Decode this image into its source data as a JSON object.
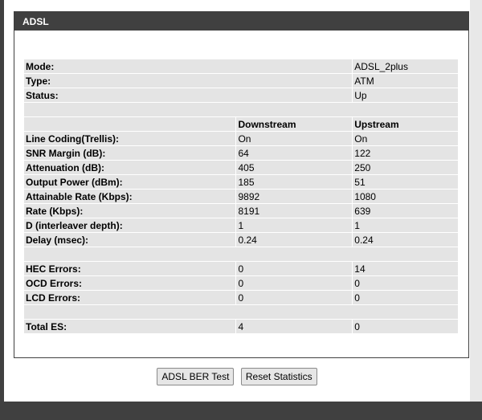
{
  "section": {
    "title": "ADSL"
  },
  "info": [
    {
      "label": "Mode:",
      "value": "ADSL_2plus"
    },
    {
      "label": "Type:",
      "value": "ATM"
    },
    {
      "label": "Status:",
      "value": "Up"
    }
  ],
  "columns": {
    "downstream": "Downstream",
    "upstream": "Upstream"
  },
  "line_stats": [
    {
      "label": "Line Coding(Trellis):",
      "down": "On",
      "up": "On"
    },
    {
      "label": "SNR Margin (dB):",
      "down": "64",
      "up": "122"
    },
    {
      "label": "Attenuation (dB):",
      "down": "405",
      "up": "250"
    },
    {
      "label": "Output Power (dBm):",
      "down": "185",
      "up": "51"
    },
    {
      "label": "Attainable Rate (Kbps):",
      "down": "9892",
      "up": "1080"
    },
    {
      "label": "Rate (Kbps):",
      "down": "8191",
      "up": "639"
    },
    {
      "label": "D (interleaver depth):",
      "down": "1",
      "up": "1"
    },
    {
      "label": "Delay (msec):",
      "down": "0.24",
      "up": "0.24"
    }
  ],
  "errors": [
    {
      "label": "HEC Errors:",
      "down": "0",
      "up": "14"
    },
    {
      "label": "OCD Errors:",
      "down": "0",
      "up": "0"
    },
    {
      "label": "LCD Errors:",
      "down": "0",
      "up": "0"
    }
  ],
  "total": {
    "label": "Total ES:",
    "down": "4",
    "up": "0"
  },
  "buttons": {
    "ber_test": "ADSL BER Test",
    "reset_stats": "Reset Statistics"
  }
}
